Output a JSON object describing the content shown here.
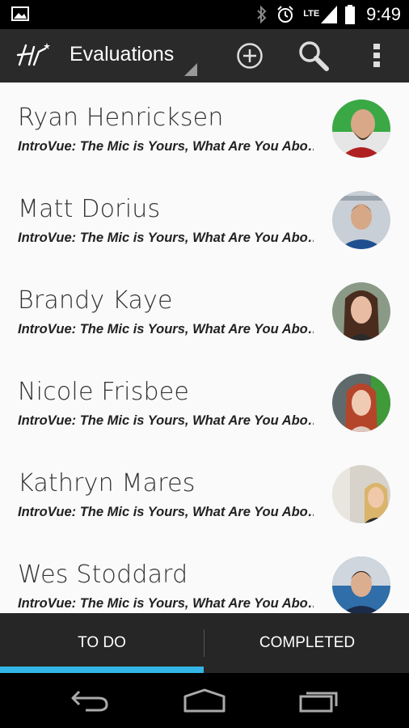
{
  "status_bar": {
    "time": "9:49",
    "network": "LTE",
    "icons": [
      "picture-icon",
      "bluetooth-icon",
      "alarm-icon",
      "lte-signal-icon",
      "battery-icon"
    ]
  },
  "action_bar": {
    "app_logo_icon": "hv-logo-icon",
    "title": "Evaluations",
    "actions": [
      "add-icon",
      "search-icon",
      "overflow-menu-icon"
    ]
  },
  "evaluations": [
    {
      "name": "Ryan Henricksen",
      "subtitle": "IntroVue: The Mic is Yours, What Are You Abo…",
      "avatar_bg": "#3aa845"
    },
    {
      "name": "Matt Dorius",
      "subtitle": "IntroVue: The Mic is Yours, What Are You Abo…",
      "avatar_bg": "#c9cfd6"
    },
    {
      "name": "Brandy Kaye",
      "subtitle": "IntroVue: The Mic is Yours, What Are You Abo…",
      "avatar_bg": "#8a9a86"
    },
    {
      "name": "Nicole Frisbee",
      "subtitle": "IntroVue: The Mic is Yours, What Are You Abo…",
      "avatar_bg": "#5f6a6c"
    },
    {
      "name": "Kathryn Mares",
      "subtitle": "IntroVue: The Mic is Yours, What Are You Abo…",
      "avatar_bg": "#d7d3cb"
    },
    {
      "name": "Wes Stoddard",
      "subtitle": "IntroVue: The Mic is Yours, What Are You Abo…",
      "avatar_bg": "#2f6ea8"
    }
  ],
  "tabs": [
    {
      "label": "TO DO",
      "selected": true
    },
    {
      "label": "COMPLETED",
      "selected": false
    }
  ],
  "colors": {
    "accent": "#33b5e5",
    "action_bar": "#2a2a2a",
    "tab_bar": "#262626"
  },
  "nav_bar": [
    "back-icon",
    "home-icon",
    "recent-apps-icon"
  ]
}
